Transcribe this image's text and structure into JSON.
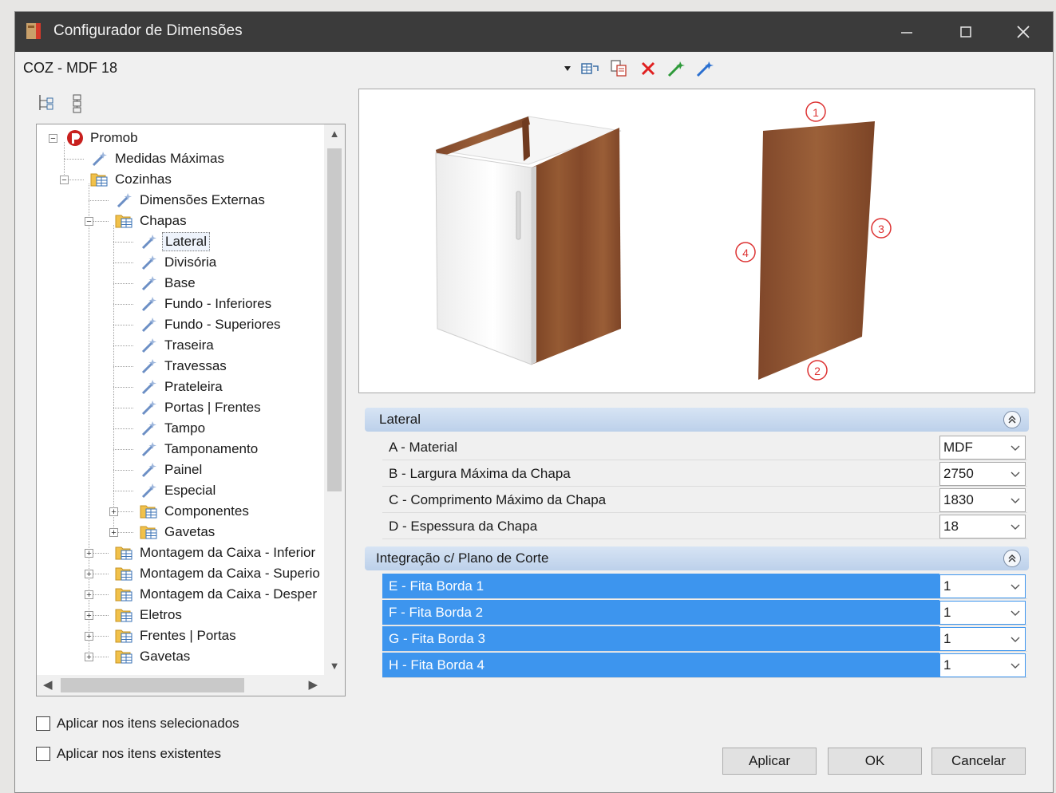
{
  "window": {
    "title": "Configurador de Dimensões"
  },
  "model": {
    "label": "COZ - MDF 18"
  },
  "tree": {
    "nodes": [
      {
        "label": "Promob",
        "level": 0,
        "icon": "promob-logo-icon",
        "expander": "−"
      },
      {
        "label": "Medidas Máximas",
        "level": 1,
        "icon": "config-wand-icon"
      },
      {
        "label": "Cozinhas",
        "level": 1,
        "icon": "folder-table-icon",
        "expander": "−"
      },
      {
        "label": "Dimensões Externas",
        "level": 2,
        "icon": "config-wand-icon"
      },
      {
        "label": "Chapas",
        "level": 2,
        "icon": "folder-table-icon",
        "expander": "−"
      },
      {
        "label": "Lateral",
        "level": 3,
        "icon": "config-wand-icon",
        "selected": true
      },
      {
        "label": "Divisória",
        "level": 3,
        "icon": "config-wand-icon"
      },
      {
        "label": "Base",
        "level": 3,
        "icon": "config-wand-icon"
      },
      {
        "label": "Fundo - Inferiores",
        "level": 3,
        "icon": "config-wand-icon"
      },
      {
        "label": "Fundo - Superiores",
        "level": 3,
        "icon": "config-wand-icon"
      },
      {
        "label": "Traseira",
        "level": 3,
        "icon": "config-wand-icon"
      },
      {
        "label": "Travessas",
        "level": 3,
        "icon": "config-wand-icon"
      },
      {
        "label": "Prateleira",
        "level": 3,
        "icon": "config-wand-icon"
      },
      {
        "label": "Portas | Frentes",
        "level": 3,
        "icon": "config-wand-icon"
      },
      {
        "label": "Tampo",
        "level": 3,
        "icon": "config-wand-icon"
      },
      {
        "label": "Tamponamento",
        "level": 3,
        "icon": "config-wand-icon"
      },
      {
        "label": "Painel",
        "level": 3,
        "icon": "config-wand-icon"
      },
      {
        "label": "Especial",
        "level": 3,
        "icon": "config-wand-icon"
      },
      {
        "label": "Componentes",
        "level": 3,
        "icon": "folder-table-icon",
        "expander": "+"
      },
      {
        "label": "Gavetas",
        "level": 3,
        "icon": "folder-table-icon",
        "expander": "+"
      },
      {
        "label": "Montagem da Caixa - Inferior",
        "level": 2,
        "icon": "folder-table-icon",
        "expander": "+"
      },
      {
        "label": "Montagem da Caixa - Superio",
        "level": 2,
        "icon": "folder-table-icon",
        "expander": "+"
      },
      {
        "label": "Montagem da Caixa - Desper",
        "level": 2,
        "icon": "folder-table-icon",
        "expander": "+"
      },
      {
        "label": "Eletros",
        "level": 2,
        "icon": "folder-table-icon",
        "expander": "+"
      },
      {
        "label": "Frentes | Portas",
        "level": 2,
        "icon": "folder-table-icon",
        "expander": "+"
      },
      {
        "label": "Gavetas",
        "level": 2,
        "icon": "folder-table-icon",
        "expander": "+"
      }
    ]
  },
  "preview": {
    "edge_labels": [
      "①",
      "②",
      "③",
      "④"
    ]
  },
  "sections": [
    {
      "title": "Lateral",
      "rows": [
        {
          "name": "A - Material",
          "value": "MDF"
        },
        {
          "name": "B - Largura Máxima da Chapa",
          "value": "2750"
        },
        {
          "name": "C - Comprimento Máximo da Chapa",
          "value": "1830"
        },
        {
          "name": "D - Espessura da Chapa",
          "value": "18"
        }
      ]
    },
    {
      "title": "Integração c/ Plano de Corte",
      "rows": [
        {
          "name": "E - Fita Borda 1",
          "value": "1",
          "highlighted": true
        },
        {
          "name": "F - Fita Borda 2",
          "value": "1",
          "highlighted": true
        },
        {
          "name": "G - Fita Borda 3",
          "value": "1",
          "highlighted": true
        },
        {
          "name": "H - Fita Borda 4",
          "value": "1",
          "highlighted": true
        }
      ]
    }
  ],
  "options": {
    "apply_selected": "Aplicar nos itens selecionados",
    "apply_existing": "Aplicar nos itens existentes"
  },
  "buttons": {
    "apply": "Aplicar",
    "ok": "OK",
    "cancel": "Cancelar"
  },
  "colors": {
    "titlebar": "#3b3b3b",
    "selection": "#3d95ee",
    "section_header": "#c8d8ee",
    "wood": "#8a4f2a"
  }
}
